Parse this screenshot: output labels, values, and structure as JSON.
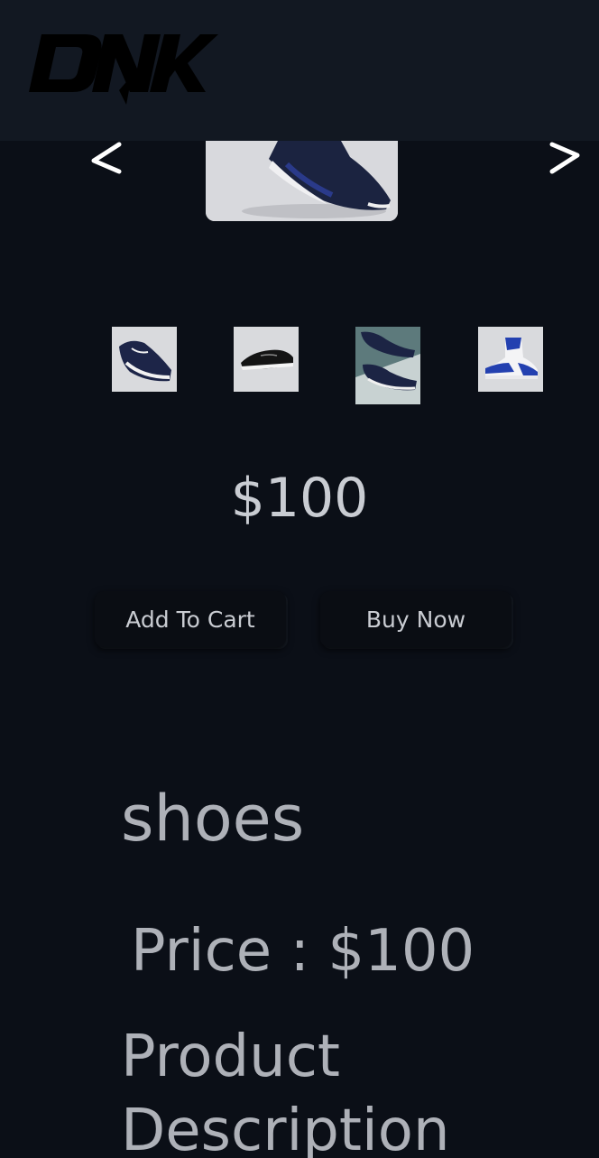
{
  "brand": {
    "logo_text": "DNK"
  },
  "slider": {
    "prev_icon": "chevron-left-icon",
    "next_icon": "chevron-right-icon",
    "main_image": "navy-sneaker-photo"
  },
  "thumbnails": [
    {
      "image": "navy-running-shoe"
    },
    {
      "image": "black-sneaker"
    },
    {
      "image": "navy-shoes-pair"
    },
    {
      "image": "blue-white-high-top"
    }
  ],
  "product": {
    "price_display": "$100",
    "name": "shoes",
    "price_line": "Price : $100",
    "description_heading": "Product Description"
  },
  "actions": {
    "add_to_cart_label": "Add To Cart",
    "buy_now_label": "Buy Now"
  },
  "colors": {
    "background": "#0b0f17",
    "header": "#121822",
    "text": "#c9ccd2"
  }
}
